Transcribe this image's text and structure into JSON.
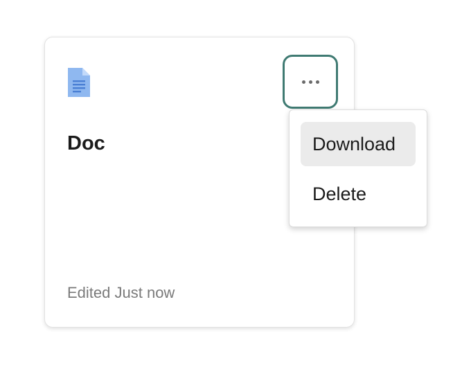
{
  "card": {
    "title": "Doc",
    "meta": "Edited Just now",
    "icon": "document-icon"
  },
  "more_button": {
    "icon": "more-horizontal-icon",
    "border_color": "#3f7a72"
  },
  "menu": {
    "items": [
      {
        "label": "Download",
        "highlighted": true
      },
      {
        "label": "Delete",
        "highlighted": false
      }
    ]
  },
  "colors": {
    "doc_icon": "#8fb8f0",
    "doc_icon_fold": "#c3dafa",
    "doc_icon_lines": "#4a7fd4",
    "highlight": "#ebebeb"
  }
}
